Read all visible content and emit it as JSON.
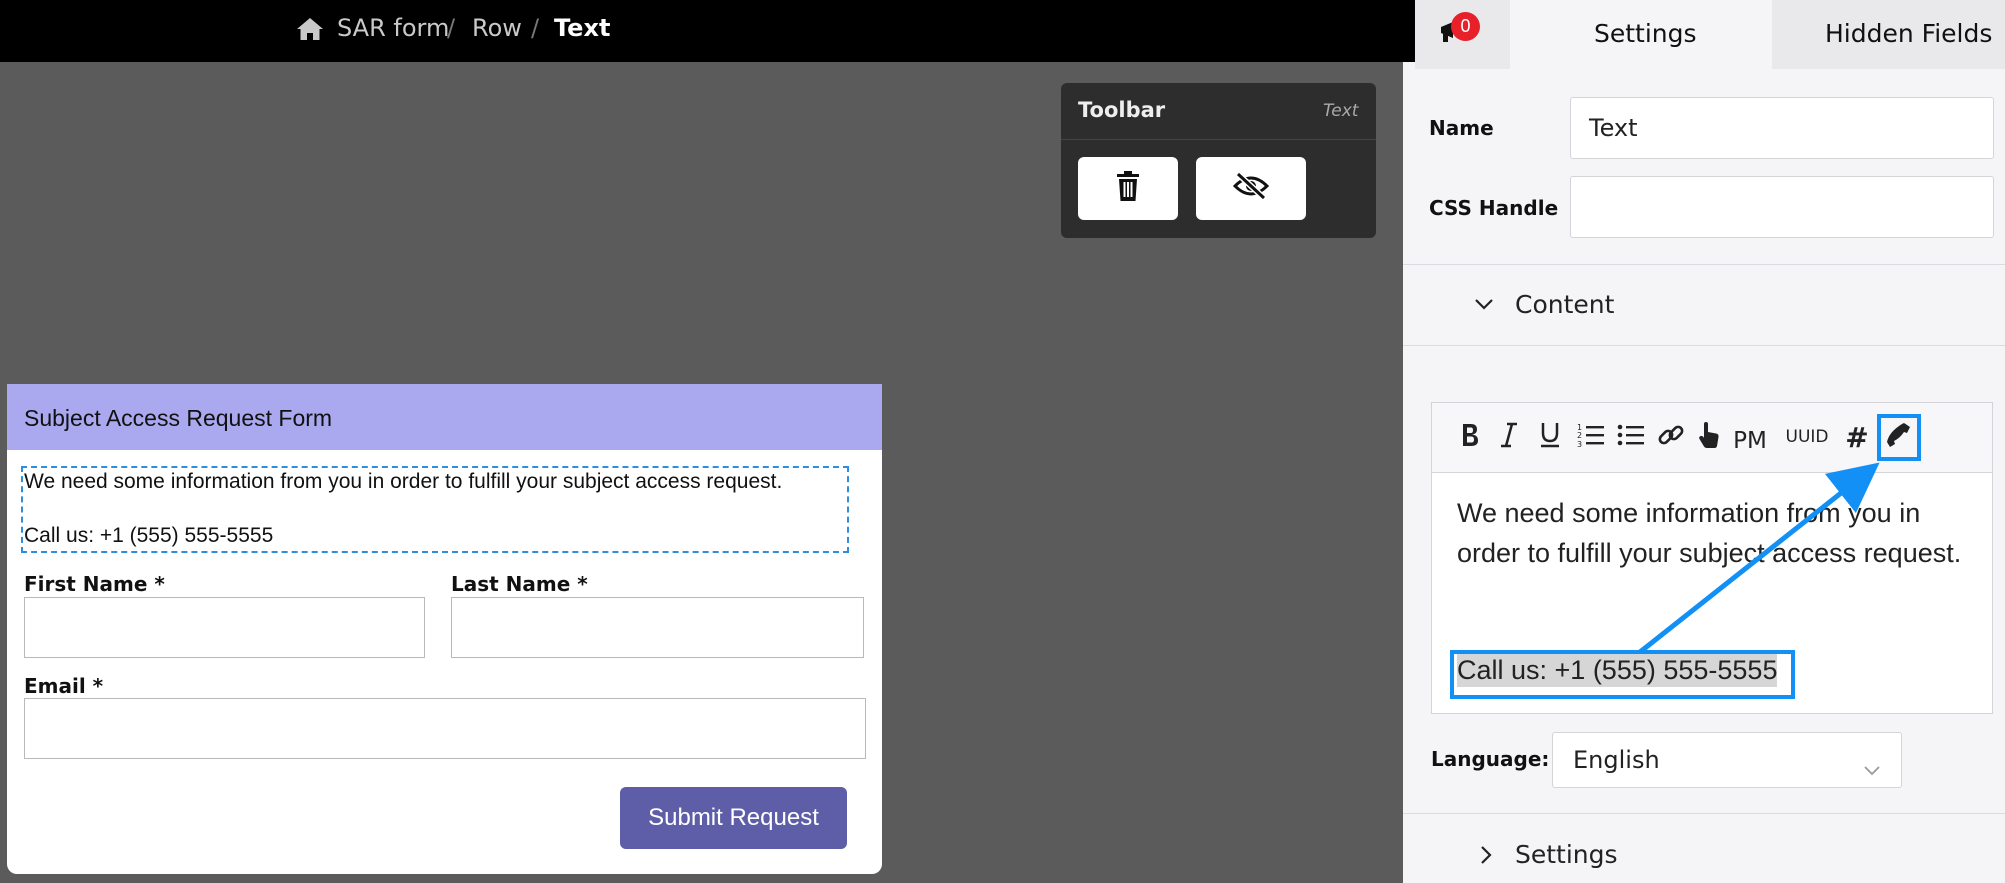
{
  "breadcrumb": {
    "items": [
      "SAR form",
      "Row",
      "Text"
    ],
    "separator": "/"
  },
  "form": {
    "title": "Subject Access Request Form",
    "intro_line1": "We need some information from you in order to fulfill your subject access request.",
    "intro_line2": "Call us: +1 (555) 555-5555",
    "first_name_label": "First Name *",
    "last_name_label": "Last Name *",
    "email_label": "Email *",
    "submit_label": "Submit Request",
    "header_color": "#aaa8ef",
    "button_color": "#5e5ea8"
  },
  "toolbar": {
    "title": "Toolbar",
    "context": "Text",
    "icons": [
      "trash-icon",
      "eye-slash-icon"
    ]
  },
  "panel": {
    "notification_count": "0",
    "tabs": [
      "Settings",
      "Hidden Fields"
    ],
    "name_label": "Name",
    "name_value": "Text",
    "css_handle_label": "CSS Handle",
    "css_handle_value": "",
    "content_section": "Content",
    "editor": {
      "tools": [
        "B",
        "I",
        "U",
        "ordered-list",
        "bullet-list",
        "link",
        "pointer",
        "PM",
        "UUID",
        "#",
        "phone"
      ],
      "pm_label": "PM",
      "uuid_label": "UUID",
      "hash_label": "#",
      "text_line1": "We need some information from you in order to fulfill your subject access request.",
      "text_line2": "Call us: +1 (555) 555-5555"
    },
    "language_label": "Language:",
    "language_value": "English",
    "settings_section": "Settings"
  },
  "annotation_color": "#1390f5"
}
